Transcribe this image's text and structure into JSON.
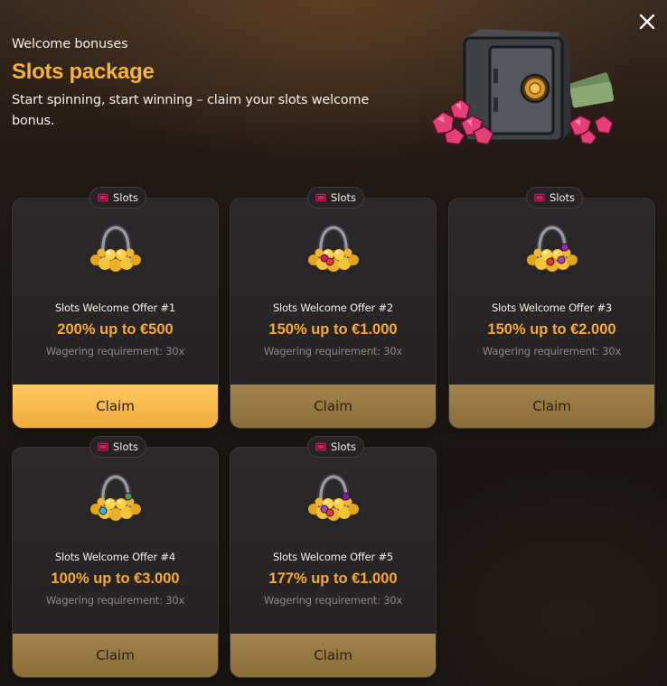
{
  "header": {
    "eyebrow": "Welcome bonuses",
    "title": "Slots package",
    "subtitle": "Start spinning, start winning – claim your slots welcome bonus."
  },
  "hero_image": "safe-with-gems-and-cash",
  "close_icon": "close-icon",
  "colors": {
    "accent": "#f7b23a",
    "primary_button": "#f1ab3d",
    "secondary_button": "#8b6d3a",
    "card": "#2b2829"
  },
  "offers": [
    {
      "tag": "Slots",
      "name": "Slots Welcome Offer #1",
      "amount": "200% up to €500",
      "wagering": "Wagering requirement: 30x",
      "claim": "Claim"
    },
    {
      "tag": "Slots",
      "name": "Slots Welcome Offer #2",
      "amount": "150% up to €1.000",
      "wagering": "Wagering requirement: 30x",
      "claim": "Claim"
    },
    {
      "tag": "Slots",
      "name": "Slots Welcome Offer #3",
      "amount": "150% up to €2.000",
      "wagering": "Wagering requirement: 30x",
      "claim": "Claim"
    },
    {
      "tag": "Slots",
      "name": "Slots Welcome Offer #4",
      "amount": "100% up to €3.000",
      "wagering": "Wagering requirement: 30x",
      "claim": "Claim"
    },
    {
      "tag": "Slots",
      "name": "Slots Welcome Offer #5",
      "amount": "177% up to €1.000",
      "wagering": "Wagering requirement: 30x",
      "claim": "Claim"
    }
  ]
}
